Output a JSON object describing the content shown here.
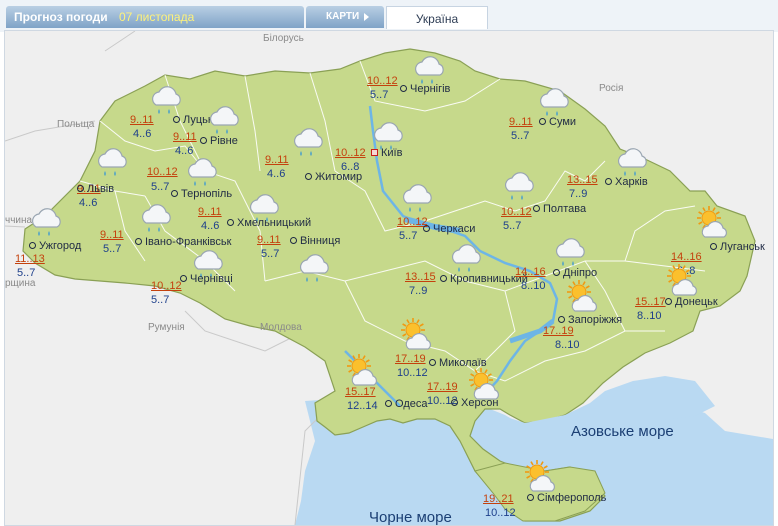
{
  "header": {
    "forecast_label": "Прогноз погоди",
    "date": "07 листопада",
    "maps_button": "КАРТИ",
    "region_tab": "Україна"
  },
  "countries": [
    "Білорусь",
    "Польща",
    "Росія",
    "Румунія",
    "Молдова",
    "ччина",
    "рщина"
  ],
  "seas": [
    "Азовське море",
    "Чорне море"
  ],
  "cities": [
    {
      "name": "Чернігів",
      "day": "10..12",
      "night": "5..7",
      "icon": "cloud-rain-icon",
      "capital": false
    },
    {
      "name": "Луцьк",
      "day": "9..11",
      "night": "4..6",
      "icon": "cloud-rain-icon",
      "capital": false
    },
    {
      "name": "Рівне",
      "day": "9..11",
      "night": "4..6",
      "icon": "cloud-rain-icon",
      "capital": false
    },
    {
      "name": "Суми",
      "day": "9..11",
      "night": "5..7",
      "icon": "cloud-rain-icon",
      "capital": false
    },
    {
      "name": "Київ",
      "day": "10..12",
      "night": "6..8",
      "icon": "cloud-rain-icon",
      "capital": true
    },
    {
      "name": "Житомир",
      "day": "9..11",
      "night": "4..6",
      "icon": "cloud-rain-icon",
      "capital": false
    },
    {
      "name": "Львів",
      "day": "9..11",
      "night": "4..6",
      "icon": "cloud-rain-icon",
      "capital": false
    },
    {
      "name": "Тернопіль",
      "day": "10..12",
      "night": "5..7",
      "icon": "cloud-rain-icon",
      "capital": false
    },
    {
      "name": "Харків",
      "day": "13..15",
      "night": "7..9",
      "icon": "cloud-rain-icon",
      "capital": false
    },
    {
      "name": "Полтава",
      "day": "10..12",
      "night": "5..7",
      "icon": "cloud-rain-icon",
      "capital": false
    },
    {
      "name": "Хмельницький",
      "day": "9..11",
      "night": "4..6",
      "icon": "cloud-rain-icon",
      "capital": false
    },
    {
      "name": "Івано-Франківськ",
      "day": "9..11",
      "night": "5..7",
      "icon": "cloud-rain-icon",
      "capital": false
    },
    {
      "name": "Ужгород",
      "day": "11..13",
      "night": "5..7",
      "icon": "cloud-rain-icon",
      "capital": false
    },
    {
      "name": "Вінниця",
      "day": "9..11",
      "night": "5..7",
      "icon": "cloud-rain-icon",
      "capital": false
    },
    {
      "name": "Черкаси",
      "day": "10..12",
      "night": "5..7",
      "icon": "cloud-rain-icon",
      "capital": false
    },
    {
      "name": "Луганськ",
      "day": "14..16",
      "night": "6..8",
      "icon": "sun-cloud-icon",
      "capital": false
    },
    {
      "name": "Чернівці",
      "day": "10..12",
      "night": "5..7",
      "icon": "cloud-rain-icon",
      "capital": false
    },
    {
      "name": "Кропивницький",
      "day": "13..15",
      "night": "7..9",
      "icon": "cloud-rain-icon",
      "capital": false
    },
    {
      "name": "Дніпро",
      "day": "14..16",
      "night": "8..10",
      "icon": "cloud-rain-icon",
      "capital": false
    },
    {
      "name": "Донецьк",
      "day": "15..17",
      "night": "8..10",
      "icon": "sun-cloud-icon",
      "capital": false
    },
    {
      "name": "Запоріжжя",
      "day": "17..19",
      "night": "8..10",
      "icon": "sun-cloud-icon",
      "capital": false
    },
    {
      "name": "Миколаїв",
      "day": "17..19",
      "night": "10..12",
      "icon": "sun-cloud-icon",
      "capital": false
    },
    {
      "name": "Одеса",
      "day": "15..17",
      "night": "12..14",
      "icon": "sun-cloud-icon",
      "capital": false
    },
    {
      "name": "Херсон",
      "day": "17..19",
      "night": "10..12",
      "icon": "sun-cloud-icon",
      "capital": false
    },
    {
      "name": "Сімферополь",
      "day": "19..21",
      "night": "10..12",
      "icon": "sun-cloud-icon",
      "capital": false
    }
  ]
}
